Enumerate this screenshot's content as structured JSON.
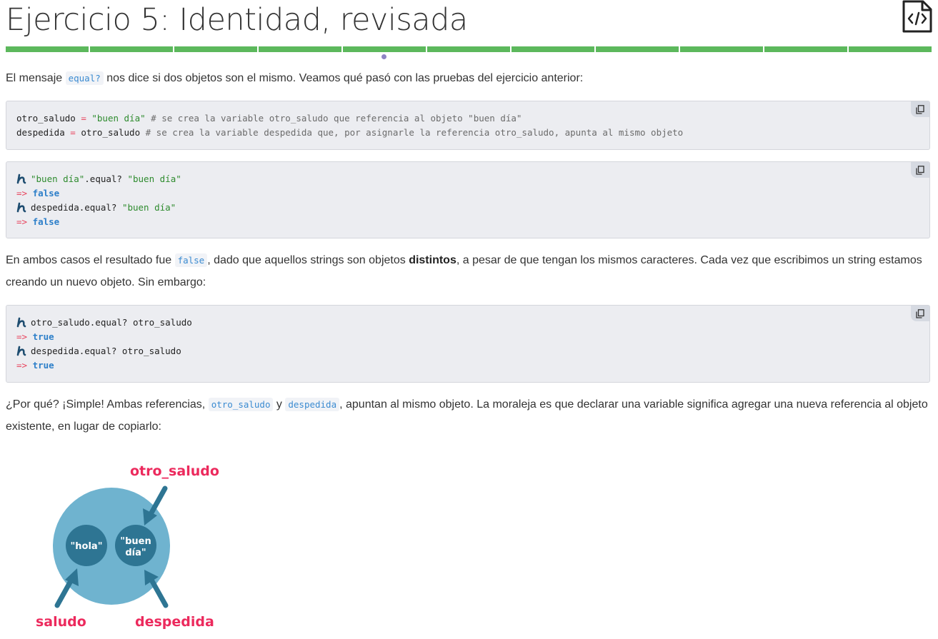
{
  "header": {
    "title": "Ejercicio 5: Identidad, revisada",
    "progress_segments": 11,
    "progress_color": "#5cb85c",
    "current_indicator_color": "#8e84c4"
  },
  "intro": {
    "text_before": "El mensaje ",
    "code": "equal?",
    "text_after": " nos dice si dos objetos son el mismo. Veamos qué pasó con las pruebas del ejercicio anterior:"
  },
  "code_block_1": {
    "line1": {
      "name": "otro_saludo",
      "op": " = ",
      "value": "\"buen día\"",
      "comment": " # se crea la variable otro_saludo que referencia al objeto \"buen día\""
    },
    "line2": {
      "name": "despedida",
      "op": " = ",
      "value": "otro_saludo",
      "comment": " # se crea la variable despedida que, por asignarle la referencia otro_saludo, apunta al mismo objeto"
    }
  },
  "console_1": [
    {
      "kind": "input",
      "parts": [
        {
          "t": "\"buen día\"",
          "c": "str"
        },
        {
          "t": ".equal? ",
          "c": ""
        },
        {
          "t": "\"buen día\"",
          "c": "str"
        }
      ]
    },
    {
      "kind": "output",
      "arrow": "=> ",
      "value": "false"
    },
    {
      "kind": "input",
      "parts": [
        {
          "t": "despedida.equal? ",
          "c": ""
        },
        {
          "t": "\"buen día\"",
          "c": "str"
        }
      ]
    },
    {
      "kind": "output",
      "arrow": "=> ",
      "value": "false"
    }
  ],
  "para2": {
    "t1": "En ambos casos el resultado fue ",
    "code": "false",
    "t2": ", dado que aquellos strings son objetos ",
    "bold": "distintos",
    "t3": ", a pesar de que tengan los mismos caracteres. Cada vez que escribimos un string estamos creando un nuevo objeto. Sin embargo:"
  },
  "console_2": [
    {
      "kind": "input",
      "text": "otro_saludo.equal? otro_saludo"
    },
    {
      "kind": "output",
      "arrow": "=> ",
      "value": "true"
    },
    {
      "kind": "input",
      "text": "despedida.equal? otro_saludo"
    },
    {
      "kind": "output",
      "arrow": "=> ",
      "value": "true"
    }
  ],
  "para3": {
    "t1": "¿Por qué? ¡Simple! Ambas referencias, ",
    "code1": "otro_saludo",
    "t2": " y ",
    "code2": "despedida",
    "t3": ", apuntan al mismo objeto. La moraleja es que declarar una variable significa agregar una nueva referencia al objeto existente, en lugar de copiarlo:"
  },
  "diagram": {
    "label_top": "otro_saludo",
    "label_left": "saludo",
    "label_right": "despedida",
    "obj1": "\"hola\"",
    "obj2_line1": "\"buen",
    "obj2_line2": "día\"",
    "outer_color": "#6fb3cf",
    "inner_color": "#2e7593",
    "label_color": "#ec2a5d"
  },
  "icons": [
    "code-file-icon",
    "copy-icon",
    "prompt-icon"
  ]
}
